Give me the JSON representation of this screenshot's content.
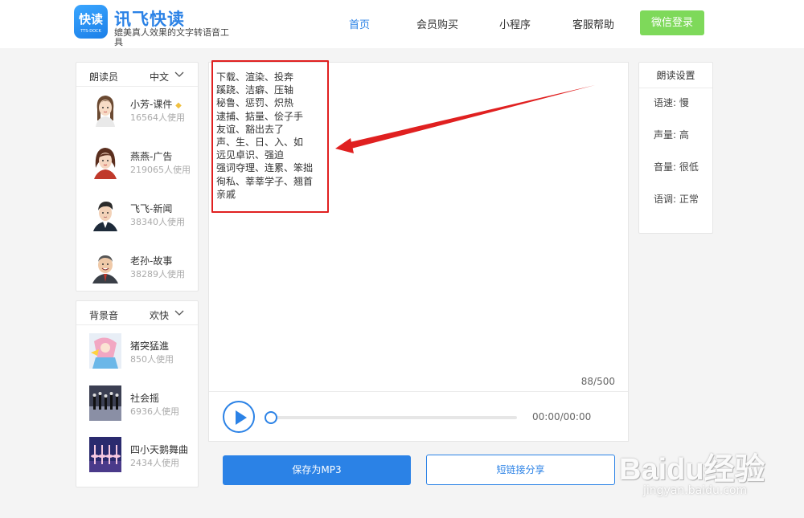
{
  "header": {
    "logo_text": "快读",
    "logo_sub": "TTS-DOCK",
    "brand": "讯飞快读",
    "slogan": "媲美真人效果的文字转语音工具",
    "nav": [
      "首页",
      "会员购买",
      "小程序",
      "客服帮助"
    ],
    "login_label": "微信登录"
  },
  "readers": {
    "title": "朗读员",
    "language": "中文",
    "items": [
      {
        "name": "小芳-课件",
        "usage": "16564人使用"
      },
      {
        "name": "燕燕-广告",
        "usage": "219065人使用"
      },
      {
        "name": "飞飞-新闻",
        "usage": "38340人使用"
      },
      {
        "name": "老孙-故事",
        "usage": "38289人使用"
      }
    ]
  },
  "music": {
    "title": "背景音",
    "style": "欢快",
    "items": [
      {
        "name": "猪突猛進",
        "usage": "850人使用"
      },
      {
        "name": "社会摇",
        "usage": "6936人使用"
      },
      {
        "name": "四小天鹅舞曲",
        "usage": "2434人使用"
      }
    ]
  },
  "editor": {
    "text": "下载、渲染、投奔\n蹊跷、洁癖、压轴\n秘鲁、惩罚、炽热\n逮捕、掂量、侩子手\n友谊、豁出去了\n声、生、日、入、如\n远见卓识、强迫\n强词夺理、连累、笨拙\n徇私、莘莘学子、翘首\n亲戚",
    "counter": "88/500"
  },
  "player": {
    "time": "00:00/00:00",
    "progress": 0
  },
  "actions": {
    "save_label": "保存为MP3",
    "share_label": "短链接分享"
  },
  "settings": {
    "title": "朗读设置",
    "items": [
      "语速: 慢",
      "声量: 高",
      "音量: 很低",
      "语调: 正常"
    ]
  },
  "watermark": {
    "brand": "Baidu经验",
    "url": "jingyan.baidu.com"
  },
  "colors": {
    "accent": "#2b82e6",
    "login": "#7ed95a",
    "annotation": "#e02020"
  }
}
